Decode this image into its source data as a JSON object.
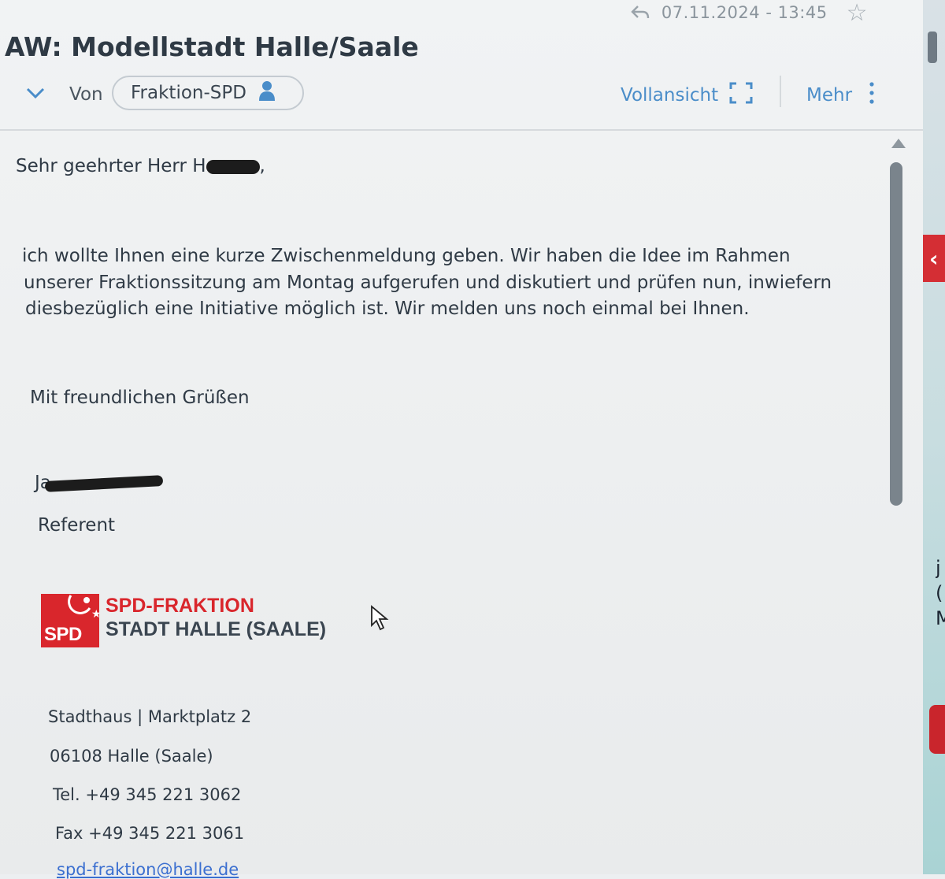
{
  "header": {
    "date": "07.11.2024 - 13:45",
    "subject": "AW: Modellstadt Halle/Saale",
    "from_label": "Von",
    "sender": "Fraktion-SPD",
    "full_view_label": "Vollansicht",
    "more_label": "Mehr"
  },
  "body": {
    "greeting": "Sehr geehrter Herr H",
    "greeting_comma": ",",
    "paragraph_lines": [
      "ich wollte Ihnen eine kurze Zwischenmeldung geben. Wir haben die Idee im Rahmen",
      "unserer Fraktionssitzung am Montag aufgerufen und diskutiert und prüfen nun, inwiefern",
      "diesbezüglich eine Initiative möglich ist. Wir melden uns noch einmal bei Ihnen."
    ],
    "closing": "Mit freundlichen Grüßen",
    "signature_initial": "Ja",
    "role": "Referent"
  },
  "signature": {
    "logo_mark": "SPD",
    "logo_title": "SPD-FRAKTION",
    "logo_subtitle": "STADT HALLE (SAALE)",
    "address_line1": "Stadthaus | Marktplatz 2",
    "address_line2": "06108 Halle (Saale)",
    "phone": "Tel. +49 345 221 3062",
    "fax": "Fax +49 345 221 3061",
    "email": "spd-fraktion@halle.de"
  },
  "right_strip": {
    "glyphs": [
      "j",
      "(",
      "M"
    ]
  },
  "colors": {
    "accent_blue": "#4a8dc9",
    "spd_red": "#d9262c",
    "text": "#2f3a45"
  }
}
